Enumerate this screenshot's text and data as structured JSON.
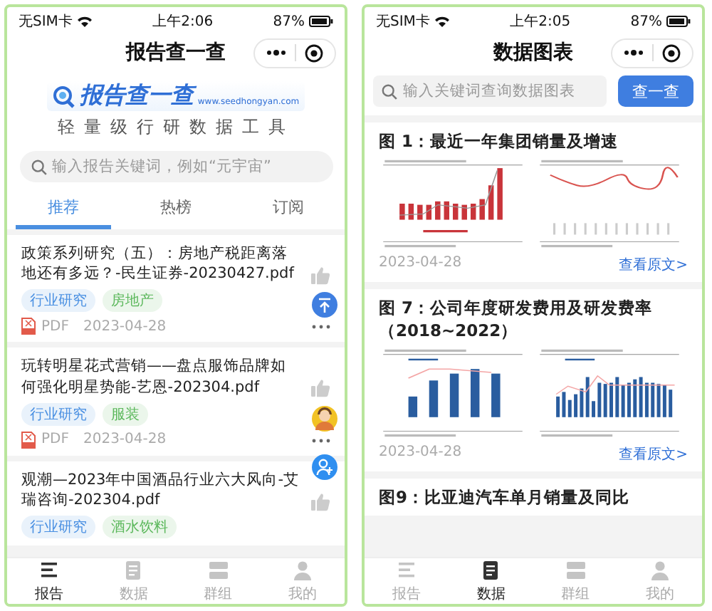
{
  "report_screen": {
    "status_bar": {
      "carrier": "无SIM卡",
      "time": "上午2:06",
      "battery": "87%"
    },
    "title": "报告查一查",
    "logo": {
      "name": "报告查一查",
      "url": "www.seedhongyan.com",
      "tagline": "轻量级行研数据工具"
    },
    "search": {
      "placeholder": "输入报告关键词，例如“元宇宙”"
    },
    "tabs": [
      {
        "label": "推荐",
        "selected": true
      },
      {
        "label": "热榜",
        "selected": false
      },
      {
        "label": "订阅",
        "selected": false
      }
    ],
    "reports": [
      {
        "title": "政策系列研究（五）：房地产税距离落地还有多远？-民生证券-20230427.pdf",
        "tags": [
          {
            "label": "行业研究",
            "color": "#4a90e2"
          },
          {
            "label": "房地产",
            "color": "#5cb85c"
          }
        ],
        "file_type": "PDF",
        "date": "2023-04-28"
      },
      {
        "title": "玩转明星花式营销——盘点服饰品牌如何强化明星势能-艺恩-202304.pdf",
        "tags": [
          {
            "label": "行业研究",
            "color": "#4a90e2"
          },
          {
            "label": "服装",
            "color": "#5cb85c"
          }
        ],
        "file_type": "PDF",
        "date": "2023-04-28"
      },
      {
        "title": "观潮—2023年中国酒品行业六大风向-艾瑞咨询-202304.pdf",
        "tags": [
          {
            "label": "行业研究",
            "color": "#4a90e2"
          },
          {
            "label": "酒水饮料",
            "color": "#5cb85c"
          }
        ]
      }
    ],
    "bottom_nav": [
      {
        "label": "报告",
        "selected": true
      },
      {
        "label": "数据",
        "selected": false
      },
      {
        "label": "群组",
        "selected": false
      },
      {
        "label": "我的",
        "selected": false
      }
    ]
  },
  "chart_screen": {
    "status_bar": {
      "carrier": "无SIM卡",
      "time": "上午2:05",
      "battery": "87%"
    },
    "title": "数据图表",
    "search": {
      "placeholder": "输入关键词查询数据图表",
      "button": "查一查"
    },
    "charts": [
      {
        "title": "图 1：最近一年集团销量及增速",
        "images": [
          {
            "kind": "red-bars"
          },
          {
            "kind": "red-line"
          }
        ],
        "date": "2023-04-28",
        "link": "查看原文>"
      },
      {
        "title": "图 7：公司年度研发费用及研发费率（2018~2022）",
        "images": [
          {
            "kind": "blue-bars"
          },
          {
            "kind": "dense-bars"
          }
        ],
        "date": "2023-04-28",
        "link": "查看原文>"
      },
      {
        "title": "图9：比亚迪汽车单月销量及同比"
      }
    ],
    "bottom_nav": [
      {
        "label": "报告",
        "selected": false
      },
      {
        "label": "数据",
        "selected": true
      },
      {
        "label": "群组",
        "selected": false
      },
      {
        "label": "我的",
        "selected": false
      }
    ]
  }
}
